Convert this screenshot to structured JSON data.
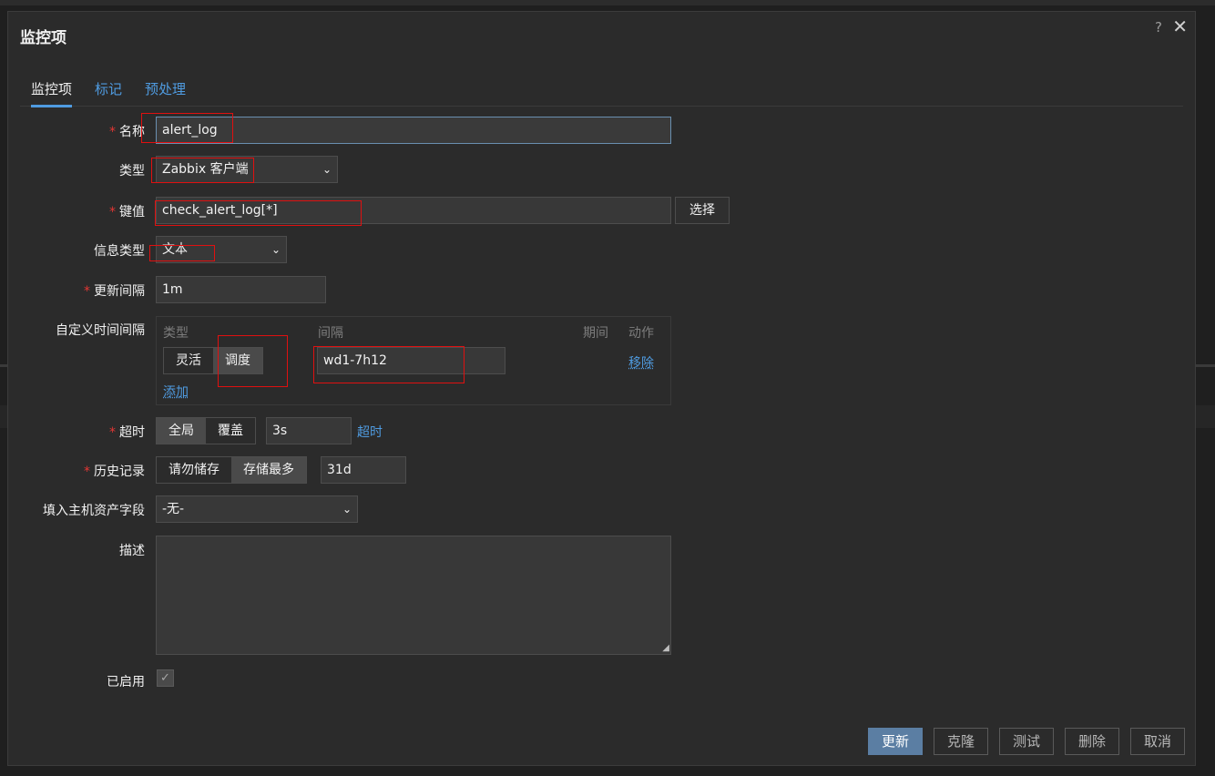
{
  "dialog": {
    "title": "监控项",
    "help": "?",
    "close": "✕"
  },
  "tabs": [
    {
      "label": "监控项",
      "active": true
    },
    {
      "label": "标记",
      "active": false
    },
    {
      "label": "预处理",
      "active": false
    }
  ],
  "form": {
    "name": {
      "label": "名称",
      "required": true,
      "value": "alert_log"
    },
    "type": {
      "label": "类型",
      "value": "Zabbix 客户端"
    },
    "key": {
      "label": "键值",
      "required": true,
      "value": "check_alert_log[*]",
      "select_button": "选择"
    },
    "info_type": {
      "label": "信息类型",
      "value": "文本"
    },
    "update_interval": {
      "label": "更新间隔",
      "required": true,
      "value": "1m"
    },
    "custom_intervals": {
      "label": "自定义时间间隔",
      "headers": {
        "type": "类型",
        "interval": "间隔",
        "period": "期间",
        "action": "动作"
      },
      "row": {
        "type_options": [
          "灵活",
          "调度"
        ],
        "selected": "调度",
        "interval_value": "wd1-7h12",
        "remove": "移除"
      },
      "add": "添加"
    },
    "timeout": {
      "label": "超时",
      "required": true,
      "options": [
        "全局",
        "覆盖"
      ],
      "selected": "全局",
      "value": "3s",
      "link": "超时"
    },
    "history": {
      "label": "历史记录",
      "required": true,
      "options": [
        "请勿储存",
        "存储最多"
      ],
      "selected": "存储最多",
      "value": "31d"
    },
    "inventory": {
      "label": "填入主机资产字段",
      "value": "-无-"
    },
    "description": {
      "label": "描述",
      "value": ""
    },
    "enabled": {
      "label": "已启用",
      "checked": true
    }
  },
  "footer": {
    "update": "更新",
    "clone": "克隆",
    "test": "测试",
    "delete": "删除",
    "cancel": "取消"
  },
  "colors": {
    "accent": "#4f9be0",
    "required": "#e33734",
    "annotation": "#e01010",
    "primary_button": "#5b7ea3"
  }
}
